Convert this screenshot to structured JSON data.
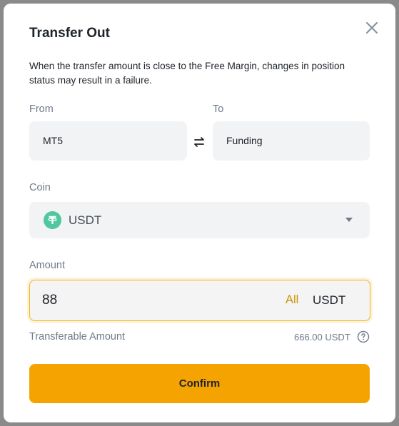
{
  "modal": {
    "title": "Transfer Out",
    "description": "When the transfer amount is close to the Free Margin, changes in position status may result in a failure."
  },
  "from": {
    "label": "From",
    "value": "MT5"
  },
  "to": {
    "label": "To",
    "value": "Funding"
  },
  "coin": {
    "label": "Coin",
    "value": "USDT",
    "icon": "tether-icon",
    "icon_color": "#50c89f"
  },
  "amount": {
    "label": "Amount",
    "value": "88",
    "all_label": "All",
    "unit": "USDT"
  },
  "transferable": {
    "label": "Transferable Amount",
    "value": "666.00 USDT"
  },
  "confirm_label": "Confirm",
  "colors": {
    "accent": "#f5a300",
    "link": "#c99400"
  }
}
